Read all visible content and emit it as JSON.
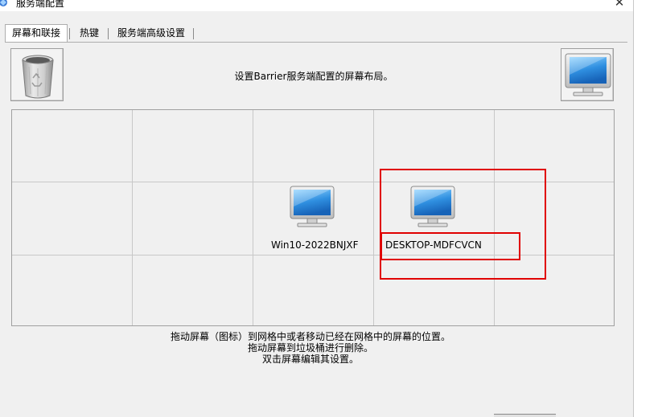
{
  "window": {
    "title": "服务端配置",
    "close_glyph": "✕"
  },
  "tabs": [
    {
      "label": "屏幕和联接",
      "active": true
    },
    {
      "label": "热键",
      "active": false
    },
    {
      "label": "服务端高级设置",
      "active": false
    }
  ],
  "layout_panel": {
    "instruction": "设置Barrier服务端配置的屏幕布局。",
    "trash_icon": "trash-can-icon",
    "new_screen_icon": "monitor-icon"
  },
  "grid": {
    "rows": 3,
    "columns": 5,
    "screens": [
      {
        "name": "Win10-2022BNJXF",
        "row": 2,
        "col": 3,
        "icon": "monitor-icon"
      },
      {
        "name": "DESKTOP-MDFCVCN",
        "row": 2,
        "col": 4,
        "icon": "monitor-icon",
        "highlighted": true
      }
    ]
  },
  "instructions": [
    "拖动屏幕（图标）到网格中或者移动已经在网格中的屏幕的位置。",
    "拖动屏幕到垃圾桶进行删除。",
    "双击屏幕编辑其设置。"
  ],
  "colors": {
    "highlight": "#e00000",
    "monitor_screen": "#2f8fe0",
    "panel_bg": "#f0f0f0"
  }
}
